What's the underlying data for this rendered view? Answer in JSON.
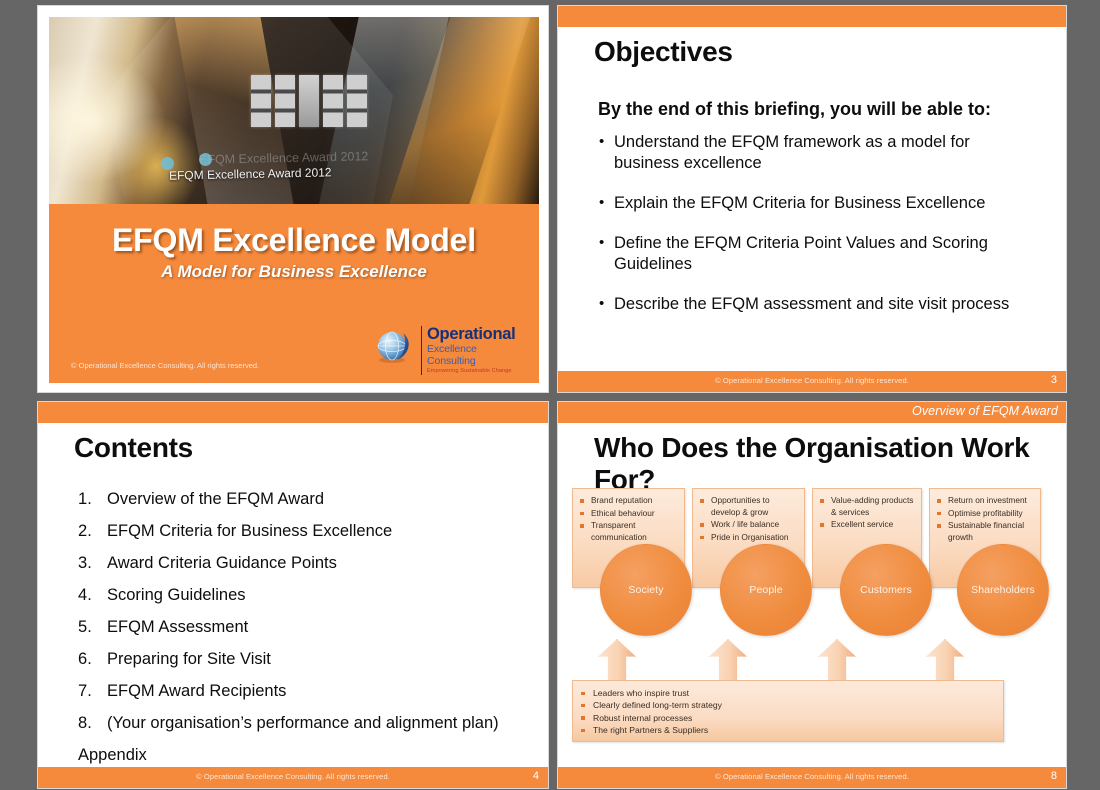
{
  "theme": {
    "accent_orange": "#F5893C",
    "page_background": "#666666",
    "slide_background": "#FFFFFF",
    "logo_blue": "#15307A",
    "logo_tagline_red": "#C0392B"
  },
  "footer": {
    "copyright": "© Operational Excellence Consulting.  All rights reserved."
  },
  "slides": {
    "title": {
      "heading": "EFQM Excellence Model",
      "subheading": "A Model for Business Excellence",
      "photo_caption": "EFQM Excellence Award 2012",
      "photo_caption_ghost": "EFQM Excellence Award 2012",
      "copyright": "© Operational Excellence Consulting.  All rights reserved.",
      "logo": {
        "line1": "Operational",
        "line2": "Excellence Consulting",
        "line3": "Empowering Sustainable Change"
      }
    },
    "objectives": {
      "title": "Objectives",
      "lead": "By the end of this briefing, you will be able to:",
      "bullets": [
        "Understand the EFQM framework as a model for business excellence",
        "Explain the EFQM Criteria for Business Excellence",
        "Define the EFQM Criteria Point Values and Scoring Guidelines",
        "Describe the EFQM assessment and site visit process"
      ],
      "page_number": "3"
    },
    "contents": {
      "title": "Contents",
      "items": [
        "Overview of the EFQM Award",
        "EFQM Criteria for Business Excellence",
        "Award Criteria Guidance Points",
        "Scoring Guidelines",
        "EFQM Assessment",
        "Preparing for Site Visit",
        "EFQM Award Recipients",
        "(Your organisation’s performance and alignment plan)"
      ],
      "appendix": "Appendix",
      "page_number": "4"
    },
    "who_works_for": {
      "section_label": "Overview of EFQM Award",
      "title": "Who Does the Organisation Work For?",
      "page_number": "8",
      "stakeholders": [
        {
          "name": "Society",
          "benefits": [
            "Brand reputation",
            "Ethical behaviour",
            "Transparent communication"
          ]
        },
        {
          "name": "People",
          "benefits": [
            "Opportunities to develop & grow",
            "Work / life balance",
            "Pride in Organisation"
          ]
        },
        {
          "name": "Customers",
          "benefits": [
            "Value-adding products & services",
            "Excellent service"
          ]
        },
        {
          "name": "Shareholders",
          "benefits": [
            "Return on investment",
            "Optimise profitability",
            "Sustainable financial growth"
          ]
        }
      ],
      "foundation": [
        "Leaders who inspire trust",
        "Clearly defined long-term strategy",
        "Robust internal processes",
        "The right Partners & Suppliers"
      ]
    }
  }
}
